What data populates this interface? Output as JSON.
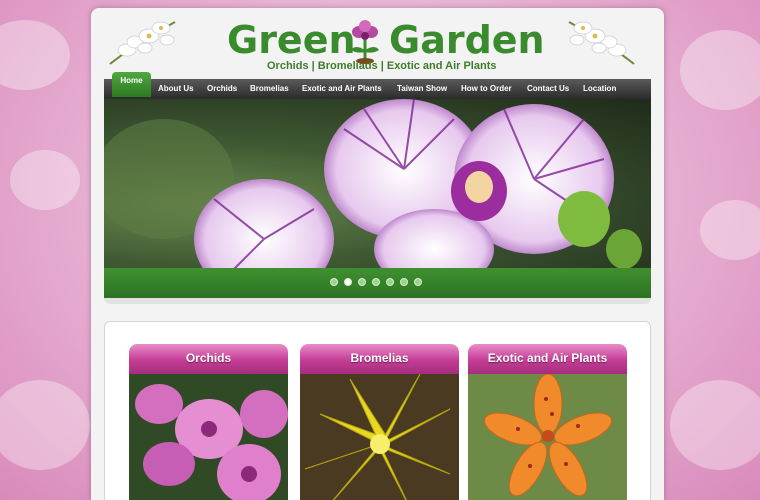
{
  "brand": {
    "name_part1": "Green",
    "name_part2": "Garden",
    "tagline": "Orchids | Bromeliads | Exotic and Air Plants",
    "green": "#3a8a2e",
    "pink": "#c43c95"
  },
  "nav": {
    "items": [
      {
        "label": "Home",
        "active": true
      },
      {
        "label": "About Us"
      },
      {
        "label": "Orchids"
      },
      {
        "label": "Bromelias"
      },
      {
        "label": "Exotic and Air Plants"
      },
      {
        "label": "Taiwan Show"
      },
      {
        "label": "How to Order"
      },
      {
        "label": "Contact Us"
      },
      {
        "label": "Location"
      }
    ]
  },
  "slider": {
    "slide_count": 7,
    "active_index": 1,
    "image": "purple-striped-orchid"
  },
  "categories": [
    {
      "title": "Orchids",
      "image": "pink-orchids"
    },
    {
      "title": "Bromelias",
      "image": "yellow-bromelia"
    },
    {
      "title": "Exotic and Air Plants",
      "image": "orange-spotted-lily"
    }
  ]
}
